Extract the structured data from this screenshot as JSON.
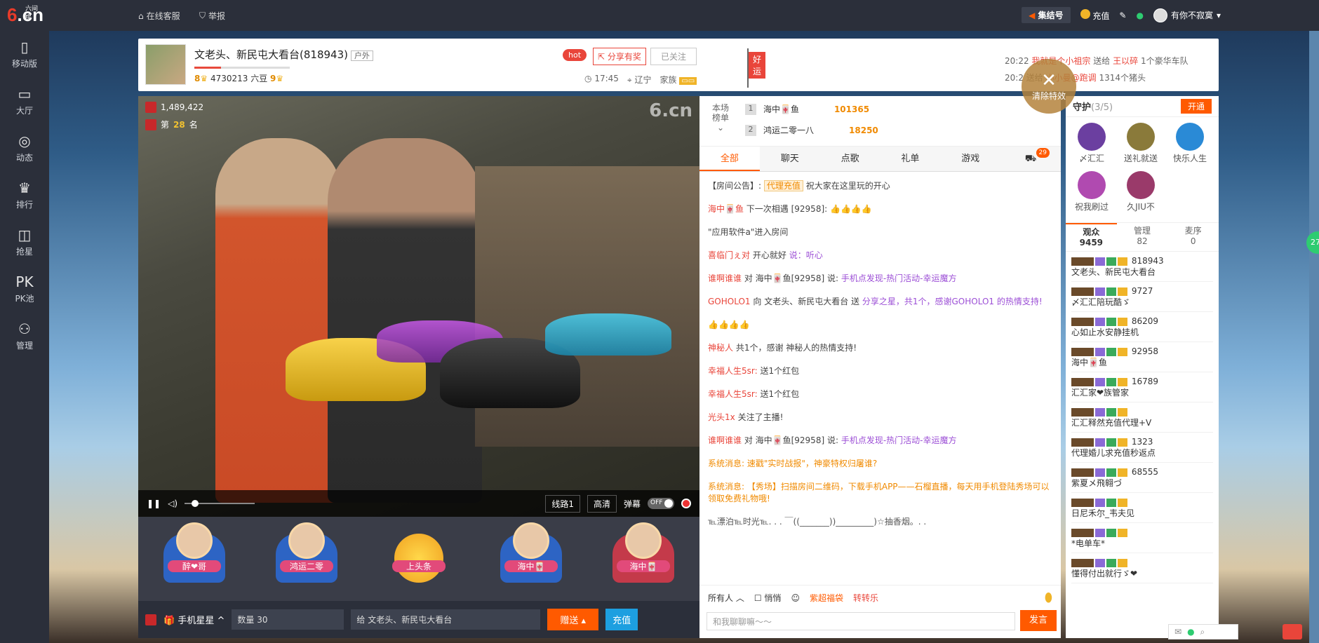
{
  "topbar": {
    "logo_text": "6.cn",
    "logo_sub": "六间房",
    "service_label": "在线客服",
    "report_label": "举报",
    "jiehao_label": "集结号",
    "charge_label": "充值",
    "username": "有你不寂寞"
  },
  "nav": [
    {
      "label": "移动版",
      "icon": "phone-icon",
      "glyph": "▯"
    },
    {
      "label": "大厅",
      "icon": "tv-icon",
      "glyph": "▭"
    },
    {
      "label": "动态",
      "icon": "compass-icon",
      "glyph": "◎"
    },
    {
      "label": "排行",
      "icon": "crown-icon",
      "glyph": "♛"
    },
    {
      "label": "抢星",
      "icon": "basket-icon",
      "glyph": "◫"
    },
    {
      "label": "PK池",
      "icon": "pk-icon",
      "glyph": "PK"
    },
    {
      "label": "管理",
      "icon": "admin-icon",
      "glyph": "⚇"
    }
  ],
  "room": {
    "title": "文老头、新民屯大看台(818943)",
    "tag": "户外",
    "beans": "4730213 六豆",
    "level_left": "8",
    "level_right": "9",
    "hot_label": "hot",
    "share_label": "分享有奖",
    "follow_label": "已关注",
    "time": "17:45",
    "location": "辽宁",
    "family_label": "家族",
    "flag_label": "好运",
    "progress": 0.28
  },
  "broadcast": [
    {
      "time": "20:22",
      "from": "我就是个小祖宗",
      "verb": "送给",
      "to": "王以碎",
      "gift": "1个豪华车队"
    },
    {
      "time": "20:2",
      "from": "",
      "verb": "送给",
      "to": "小小曼@跑调",
      "gift": "1314个猪头"
    }
  ],
  "clear_fx_label": "清除特效",
  "video": {
    "viewers": "1,489,422",
    "rank_prefix": "第",
    "rank_num": "28",
    "rank_suffix": "名",
    "watermark": "6.cn",
    "line_label": "线路1",
    "quality_label": "高清",
    "danmu_label": "弹幕",
    "danmu_state": "OFF",
    "volume": 0.1
  },
  "seats": [
    {
      "label": "醉❤哥",
      "type": "blue"
    },
    {
      "label": "鸿运二零",
      "type": "blue"
    },
    {
      "label": "上头条",
      "type": "star"
    },
    {
      "label": "海中🀄",
      "type": "blue"
    },
    {
      "label": "海中🀄",
      "type": "gold"
    }
  ],
  "giftbar": {
    "gift_name": "手机星星",
    "qty_label": "数量",
    "qty": "30",
    "to_label": "给",
    "to_name": "文老头、新民屯大看台",
    "send_label": "赠送",
    "charge_label": "充值"
  },
  "toprank": {
    "label_line1": "本场",
    "label_line2": "榜单",
    "rows": [
      {
        "n": "1",
        "name": "海中🀄鱼",
        "value": "101365"
      },
      {
        "n": "2",
        "name": "鸿运二零一八",
        "value": "18250"
      }
    ]
  },
  "chat_tabs": [
    {
      "label": "全部",
      "active": true
    },
    {
      "label": "聊天",
      "active": false
    },
    {
      "label": "点歌",
      "active": false
    },
    {
      "label": "礼单",
      "active": false
    },
    {
      "label": "游戏",
      "active": false
    },
    {
      "label": "",
      "active": false,
      "badge": "29"
    }
  ],
  "chat": {
    "notice_label": "【房间公告】:",
    "notice_tag": "代理充值",
    "notice_text": "祝大家在这里玩的开心",
    "messages": [
      {
        "a": "海中🀄鱼",
        "b": "下一次相遇 [92958]:",
        "c": "👍👍👍👍"
      },
      {
        "a": "",
        "b": "\"应用软件a\"进入房间",
        "c": ""
      },
      {
        "a": "喜临门ぇ对",
        "b": "开心就好",
        "c": "说：听心"
      },
      {
        "a": "谁啊谁谁",
        "b": "对 海中🀄鱼[92958] 说:",
        "c": "手机点发现-热门活动-幸运魔方"
      },
      {
        "a": "GOHOLO1",
        "b": "向 文老头、新民屯大看台 送",
        "c": "分享之星，共1个，感谢GOHOLO1 的热情支持!"
      },
      {
        "a": "",
        "b": "👍👍👍👍",
        "c": ""
      },
      {
        "a": "神秘人",
        "b": "共1个，感谢 神秘人的热情支持!",
        "c": ""
      },
      {
        "a": "幸福人生5sr:",
        "b": "送1个红包",
        "c": ""
      },
      {
        "a": "幸福人生5sr:",
        "b": "送1个红包",
        "c": ""
      },
      {
        "a": "光头1x",
        "b": "关注了主播!",
        "c": ""
      },
      {
        "a": "谁啊谁谁",
        "b": "对 海中🀄鱼[92958] 说:",
        "c": "手机点发现-热门活动-幸运魔方"
      }
    ],
    "sys1": "系统消息: 速戳\"实时战报\"，神豪特权归屠谁?",
    "sys2": "系统消息: 【秀场】扫描房间二维码，下载手机APP——石榴直播，每天用手机登陆秀场可以领取免费礼物哦!",
    "last": "℡漂泊℡时光℡. . .  ￣((_______))_________)☆抽香烟。. .",
    "to_all": "所有人",
    "whisper": "悄悄",
    "game1": "紫超福袋",
    "game2": "转转乐",
    "input_placeholder": "和我聊聊嘛～～",
    "send_label": "发言"
  },
  "guard": {
    "title": "守护",
    "count": "(3/5)",
    "open_label": "开通",
    "members": [
      {
        "name": "〆汇汇",
        "color": "#6b3fa0"
      },
      {
        "name": "送礼就送",
        "color": "#8a7a3a"
      },
      {
        "name": "快乐人生",
        "color": "#2a8ad6"
      },
      {
        "name": "祝我刷过",
        "color": "#b04ab0"
      },
      {
        "name": "久JIU不",
        "color": "#9a3a6a"
      }
    ]
  },
  "user_tabs": [
    {
      "label": "观众",
      "count": "9459",
      "active": true
    },
    {
      "label": "管理",
      "count": "82",
      "active": false
    },
    {
      "label": "麦序",
      "count": "0",
      "active": false
    }
  ],
  "users": [
    {
      "id": "818943",
      "name": "文老头、新民屯大看台"
    },
    {
      "id": "9727",
      "name": "〆汇汇陪玩酷ゞ"
    },
    {
      "id": "86209",
      "name": "心如止水安静挂机"
    },
    {
      "id": "92958",
      "name": "海中🀄鱼"
    },
    {
      "id": "16789",
      "name": "汇汇家❤族管家"
    },
    {
      "id": "",
      "name": "汇汇释然充值代理+V"
    },
    {
      "id": "1323",
      "name": "代理婚儿求充值秒返点"
    },
    {
      "id": "68555",
      "name": "紫夏メ飛翱づ"
    },
    {
      "id": "",
      "name": "日尼禾尔_韦夫见"
    },
    {
      "id": "",
      "name": "*电单车*"
    },
    {
      "id": "",
      "name": "懂得付出就行ゞ❤"
    }
  ],
  "side_badge": "27"
}
